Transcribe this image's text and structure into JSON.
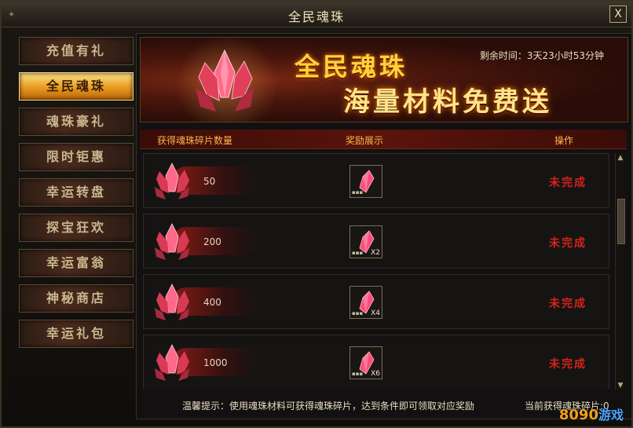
{
  "window": {
    "title": "全民魂珠",
    "close_label": "X"
  },
  "sidebar": {
    "items": [
      {
        "label": "充值有礼",
        "active": false
      },
      {
        "label": "全民魂珠",
        "active": true
      },
      {
        "label": "魂珠豪礼",
        "active": false
      },
      {
        "label": "限时钜惠",
        "active": false
      },
      {
        "label": "幸运转盘",
        "active": false
      },
      {
        "label": "探宝狂欢",
        "active": false
      },
      {
        "label": "幸运富翁",
        "active": false
      },
      {
        "label": "神秘商店",
        "active": false
      },
      {
        "label": "幸运礼包",
        "active": false
      }
    ]
  },
  "banner": {
    "title": "全民魂珠",
    "subtitle": "海量材料免费送",
    "timer_label": "剩余时间：3天23小时53分钟"
  },
  "table": {
    "headers": {
      "quantity": "获得魂珠碎片数量",
      "reward": "奖励展示",
      "action": "操作"
    },
    "rows": [
      {
        "quantity": "50",
        "reward_multiplier": "",
        "status": "未完成"
      },
      {
        "quantity": "200",
        "reward_multiplier": "X2",
        "status": "未完成"
      },
      {
        "quantity": "400",
        "reward_multiplier": "X4",
        "status": "未完成"
      },
      {
        "quantity": "1000",
        "reward_multiplier": "X6",
        "status": "未完成"
      }
    ]
  },
  "footer": {
    "tip": "温馨提示：使用魂珠材料可获得魂珠碎片，达到条件即可领取对应奖励",
    "current": "当前获得魂珠碎片:0"
  },
  "watermark": {
    "brand": "8090",
    "suffix": "游戏"
  },
  "colors": {
    "accent": "#ffd23a",
    "status": "#d4241a",
    "header": "#ffb64a"
  }
}
